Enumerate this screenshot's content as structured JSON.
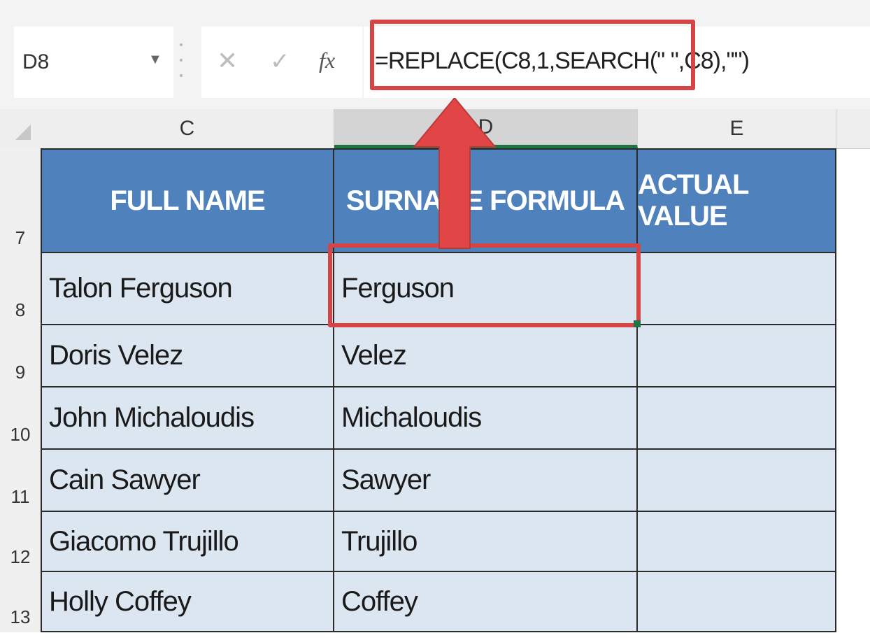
{
  "name_box": {
    "value": "D8",
    "dropdown_icon": "chevron-down-icon"
  },
  "formula_bar": {
    "cancel_symbol": "✕",
    "enter_symbol": "✓",
    "fx_symbol": "fx",
    "formula": "=REPLACE(C8,1,SEARCH(\" \",C8),\"\")"
  },
  "columns": [
    {
      "letter": "C"
    },
    {
      "letter": "D"
    },
    {
      "letter": "E"
    }
  ],
  "header_row": {
    "row_number": "7",
    "labels": [
      "FULL NAME",
      "SURNAME FORMULA",
      "ACTUAL VALUE"
    ]
  },
  "rows": [
    {
      "row_number": "8",
      "full_name": "Talon Ferguson",
      "surname": "Ferguson",
      "actual": ""
    },
    {
      "row_number": "9",
      "full_name": "Doris Velez",
      "surname": "Velez",
      "actual": ""
    },
    {
      "row_number": "10",
      "full_name": "John Michaloudis",
      "surname": "Michaloudis",
      "actual": ""
    },
    {
      "row_number": "11",
      "full_name": "Cain Sawyer",
      "surname": "Sawyer",
      "actual": ""
    },
    {
      "row_number": "12",
      "full_name": "Giacomo Trujillo",
      "surname": "Trujillo",
      "actual": ""
    },
    {
      "row_number": "13",
      "full_name": "Holly Coffey",
      "surname": "Coffey",
      "actual": ""
    }
  ],
  "colors": {
    "header_bg": "#4f81bd",
    "body_bg": "#dce6f1",
    "highlight": "#d64545",
    "selection_green": "#217346"
  }
}
